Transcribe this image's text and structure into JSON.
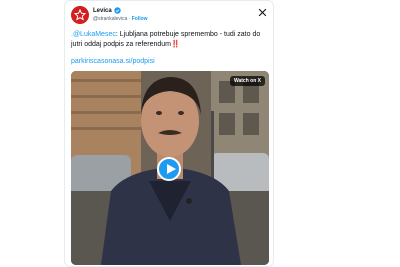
{
  "account": {
    "name": "Levica",
    "handle": "@strankalevica",
    "separator": "·",
    "follow_label": "Follow"
  },
  "tweet": {
    "mention": ".@LukaMesec",
    "text": ": Ljubljana potrebuje spremembo - tudi zato do jutri oddaj podpis za referendum",
    "emoji": "‼️",
    "link": "parkiriscasonasa.si/podpisi"
  },
  "media": {
    "watch_label": "Watch on X"
  },
  "colors": {
    "brand_red": "#d21e1e",
    "accent_blue": "#1d9bf0"
  }
}
